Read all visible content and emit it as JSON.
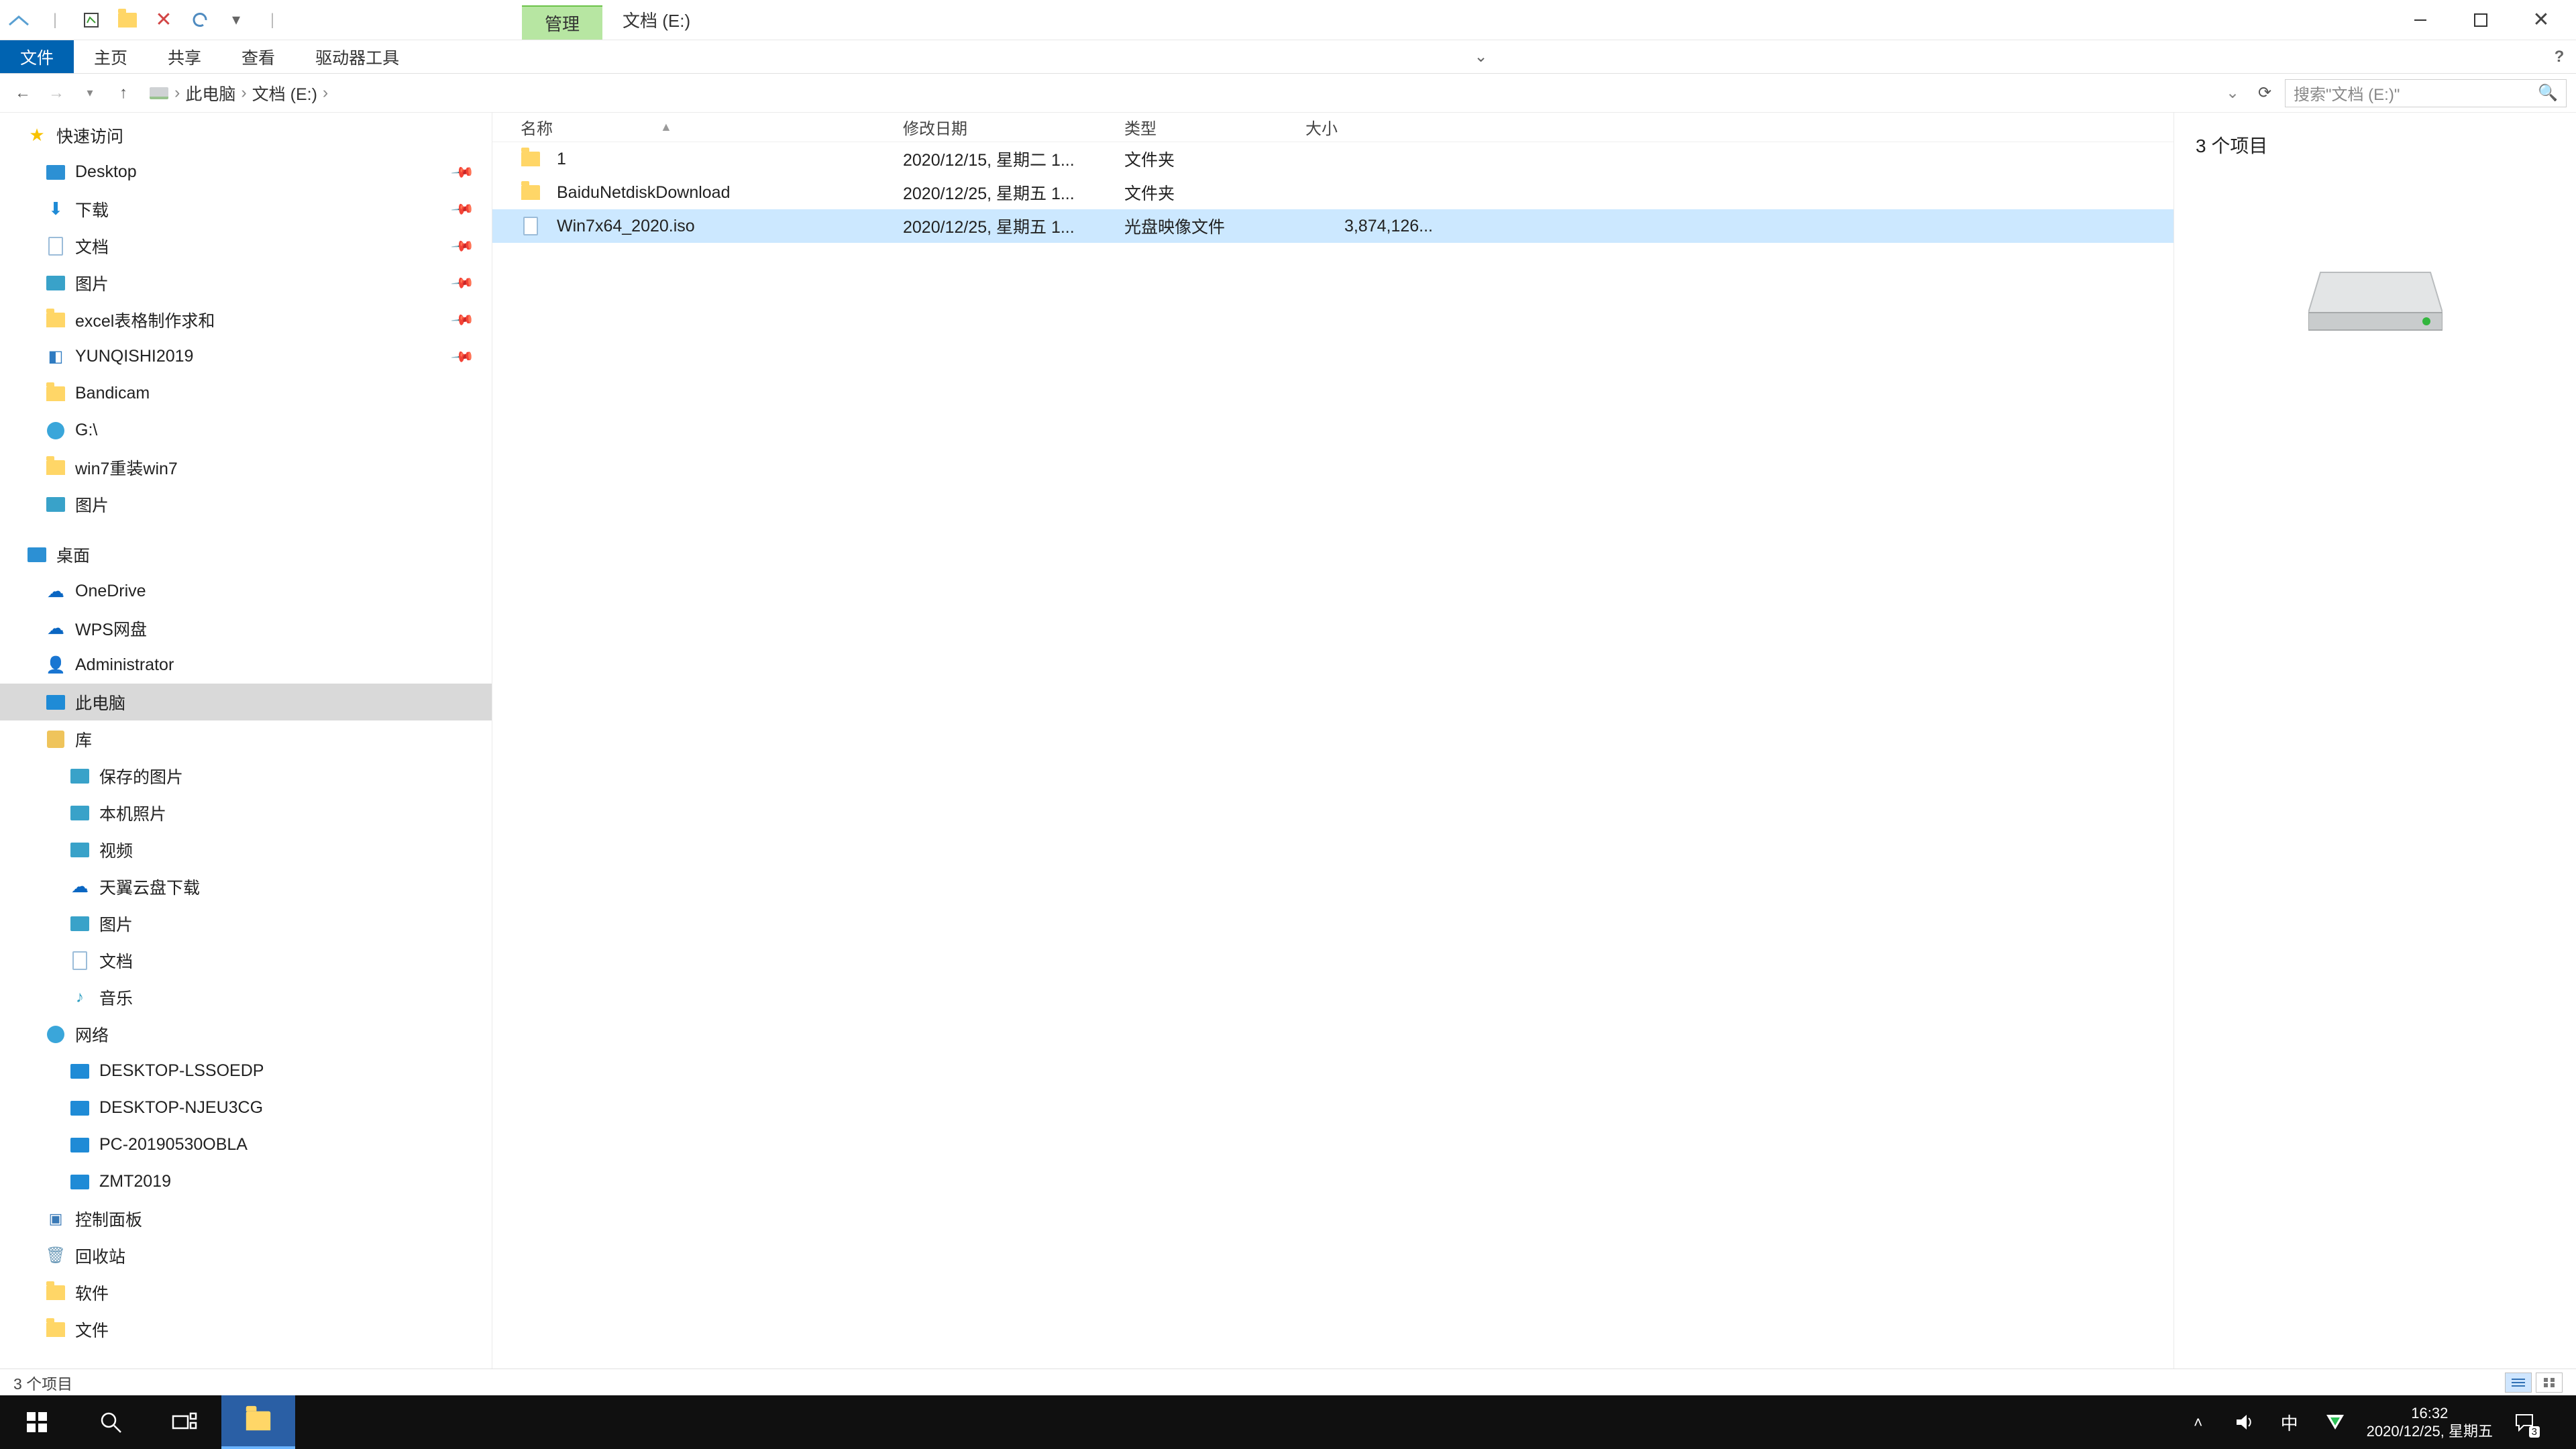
{
  "title_tab": "管理",
  "drive_label": "文档 (E:)",
  "ribbon": {
    "file": "文件",
    "home": "主页",
    "share": "共享",
    "view": "查看",
    "drivetools": "驱动器工具"
  },
  "breadcrumbs": [
    "此电脑",
    "文档 (E:)"
  ],
  "search_placeholder": "搜索\"文档 (E:)\"",
  "columns": {
    "name": "名称",
    "date": "修改日期",
    "type": "类型",
    "size": "大小"
  },
  "rows": [
    {
      "name": "1",
      "date": "2020/12/15, 星期二 1...",
      "type": "文件夹",
      "size": "",
      "icon": "folder",
      "sel": false
    },
    {
      "name": "BaiduNetdiskDownload",
      "date": "2020/12/25, 星期五 1...",
      "type": "文件夹",
      "size": "",
      "icon": "folder",
      "sel": false
    },
    {
      "name": "Win7x64_2020.iso",
      "date": "2020/12/25, 星期五 1...",
      "type": "光盘映像文件",
      "size": "3,874,126...",
      "icon": "file",
      "sel": true
    }
  ],
  "preview_count": "3 个项目",
  "status_text": "3 个项目",
  "sidebar": [
    {
      "label": "快速访问",
      "icon": "star",
      "lvl": 0
    },
    {
      "label": "Desktop",
      "icon": "desktop",
      "lvl": 1,
      "pin": true
    },
    {
      "label": "下载",
      "icon": "download",
      "lvl": 1,
      "pin": true
    },
    {
      "label": "文档",
      "icon": "doc",
      "lvl": 1,
      "pin": true
    },
    {
      "label": "图片",
      "icon": "pic",
      "lvl": 1,
      "pin": true
    },
    {
      "label": "excel表格制作求和",
      "icon": "folder",
      "lvl": 1,
      "pin": true
    },
    {
      "label": "YUNQISHI2019",
      "icon": "app",
      "lvl": 1,
      "pin": true
    },
    {
      "label": "Bandicam",
      "icon": "folder",
      "lvl": 1
    },
    {
      "label": "G:\\",
      "icon": "net",
      "lvl": 1
    },
    {
      "label": "win7重装win7",
      "icon": "folder",
      "lvl": 1
    },
    {
      "label": "图片",
      "icon": "pic",
      "lvl": 1
    }
  ],
  "sidebar2": [
    {
      "label": "桌面",
      "icon": "desktop",
      "lvl": 0
    },
    {
      "label": "OneDrive",
      "icon": "onedrive",
      "lvl": 1
    },
    {
      "label": "WPS网盘",
      "icon": "onedrive",
      "lvl": 1
    },
    {
      "label": "Administrator",
      "icon": "user",
      "lvl": 1
    },
    {
      "label": "此电脑",
      "icon": "pc",
      "lvl": 1,
      "sel": true
    },
    {
      "label": "库",
      "icon": "lib",
      "lvl": 1
    },
    {
      "label": "保存的图片",
      "icon": "pic",
      "lvl": 2
    },
    {
      "label": "本机照片",
      "icon": "pic",
      "lvl": 2
    },
    {
      "label": "视频",
      "icon": "pic",
      "lvl": 2
    },
    {
      "label": "天翼云盘下载",
      "icon": "onedrive",
      "lvl": 2
    },
    {
      "label": "图片",
      "icon": "pic",
      "lvl": 2
    },
    {
      "label": "文档",
      "icon": "doc",
      "lvl": 2
    },
    {
      "label": "音乐",
      "icon": "music",
      "lvl": 2
    },
    {
      "label": "网络",
      "icon": "net",
      "lvl": 1
    },
    {
      "label": "DESKTOP-LSSOEDP",
      "icon": "pc",
      "lvl": 2
    },
    {
      "label": "DESKTOP-NJEU3CG",
      "icon": "pc",
      "lvl": 2
    },
    {
      "label": "PC-20190530OBLA",
      "icon": "pc",
      "lvl": 2
    },
    {
      "label": "ZMT2019",
      "icon": "pc",
      "lvl": 2
    },
    {
      "label": "控制面板",
      "icon": "panel",
      "lvl": 1
    },
    {
      "label": "回收站",
      "icon": "bin",
      "lvl": 1
    },
    {
      "label": "软件",
      "icon": "folder",
      "lvl": 1
    },
    {
      "label": "文件",
      "icon": "folder",
      "lvl": 1
    }
  ],
  "clock": {
    "time": "16:32",
    "date": "2020/12/25, 星期五"
  },
  "ime": "中",
  "action_badge": "3"
}
